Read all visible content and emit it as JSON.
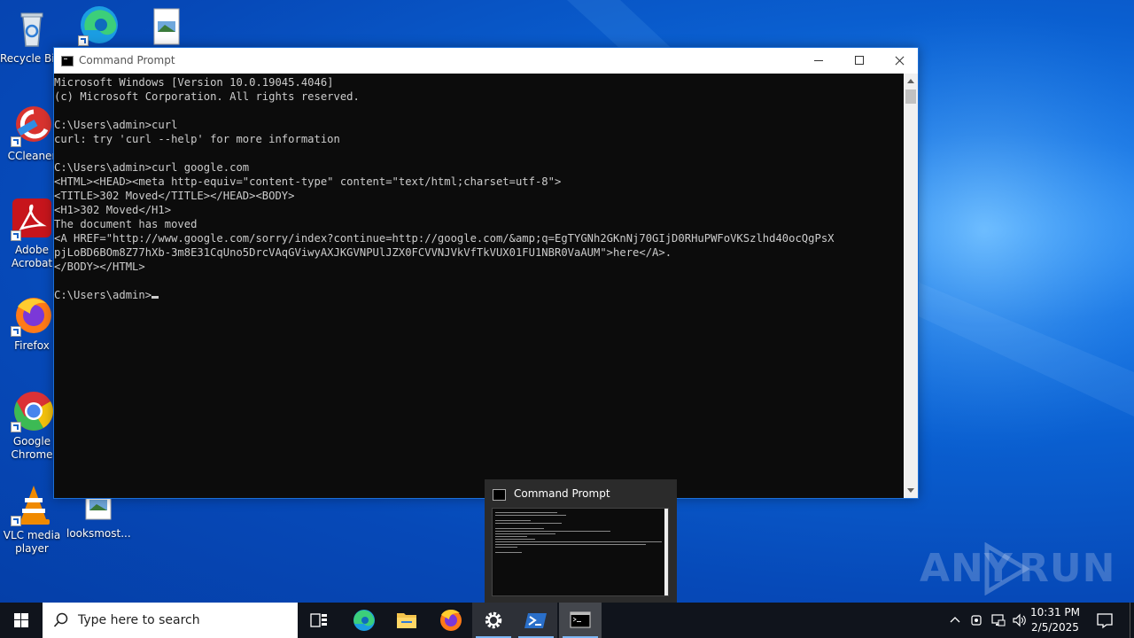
{
  "desktop": {
    "icons": [
      {
        "label": "Recycle Bin",
        "icon": "recycle-bin-icon"
      },
      {
        "label": "",
        "icon": "edge-icon"
      },
      {
        "label": "",
        "icon": "image-file-icon"
      },
      {
        "label": "CCleaner",
        "icon": "ccleaner-icon"
      },
      {
        "label": "Adobe Acrobat",
        "icon": "acrobat-icon"
      },
      {
        "label": "Firefox",
        "icon": "firefox-icon"
      },
      {
        "label": "Google Chrome",
        "icon": "chrome-icon"
      },
      {
        "label": "VLC media player",
        "icon": "vlc-icon"
      },
      {
        "label": "looksmost...",
        "icon": "image-file-icon"
      }
    ]
  },
  "window": {
    "title": "Command Prompt",
    "console_lines": [
      "Microsoft Windows [Version 10.0.19045.4046]",
      "(c) Microsoft Corporation. All rights reserved.",
      "",
      "C:\\Users\\admin>curl",
      "curl: try 'curl --help' for more information",
      "",
      "C:\\Users\\admin>curl google.com",
      "<HTML><HEAD><meta http-equiv=\"content-type\" content=\"text/html;charset=utf-8\">",
      "<TITLE>302 Moved</TITLE></HEAD><BODY>",
      "<H1>302 Moved</H1>",
      "The document has moved",
      "<A HREF=\"http://www.google.com/sorry/index?continue=http://google.com/&amp;q=EgTYGNh2GKnNj70GIjD0RHuPWFoVKSzlhd40ocQgPsX",
      "pjLoBD6BOm8Z77hXb-3m8E31CqUno5DrcVAqGViwyAXJKGVNPUlJZX0FCVVNJVkVfTkVUX01FU1NBR0VaAUM\">here</A>.",
      "</BODY></HTML>",
      "",
      "C:\\Users\\admin>"
    ]
  },
  "preview": {
    "title": "Command Prompt"
  },
  "watermark": {
    "text_left": "ANY",
    "text_right": "RUN"
  },
  "taskbar": {
    "search_placeholder": "Type here to search",
    "pinned": [
      {
        "name": "task-view",
        "icon": "task-view-icon"
      },
      {
        "name": "edge",
        "icon": "edge-icon"
      },
      {
        "name": "file-explorer",
        "icon": "folder-icon"
      },
      {
        "name": "firefox",
        "icon": "firefox-icon"
      },
      {
        "name": "settings",
        "icon": "gear-icon"
      },
      {
        "name": "powershell",
        "icon": "powershell-icon"
      },
      {
        "name": "command-prompt",
        "icon": "cmd-icon"
      }
    ],
    "clock": {
      "time": "10:31 PM",
      "date": "2/5/2025"
    }
  }
}
